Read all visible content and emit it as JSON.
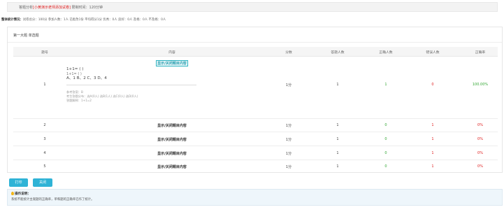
{
  "header": {
    "text_pre": "答题分析",
    "text_red": "[小黄演示老师添加试卷]",
    "text_post": "   限制时间：120分钟"
  },
  "stats": {
    "label": "整体统计情况：",
    "text": "试卷总分：100分  参加人数：1人  已批改1份  平均得分1分  优秀：0人  良好：0人  及格：0人  不及格：0人"
  },
  "section": {
    "title": "第一大题  单选题"
  },
  "table": {
    "headers": [
      "题号",
      "内容",
      "分数",
      "答题人数",
      "正确人数",
      "错误人数",
      "正确率"
    ],
    "toggle_label": "显示/关闭题目内容",
    "rows": [
      {
        "no": "1",
        "score": "1分",
        "answered": "1",
        "correct": "1",
        "wrong": "0",
        "rate": "100.00%",
        "expanded": true,
        "question_lines": [
          "1+1= ( )",
          "1+1= ( )",
          "A、1  B、2  C、3  D、4"
        ],
        "meta_lines": [
          "参考答案：B",
          "考生答题分布：选A(0人) 选B(1人) 选C(0人) 选D(0人)",
          "答题解释：1+1=2"
        ]
      },
      {
        "no": "2",
        "score": "1分",
        "answered": "1",
        "correct": "0",
        "wrong": "1",
        "rate": "0%"
      },
      {
        "no": "3",
        "score": "1分",
        "answered": "1",
        "correct": "0",
        "wrong": "1",
        "rate": "0%"
      },
      {
        "no": "4",
        "score": "1分",
        "answered": "1",
        "correct": "0",
        "wrong": "1",
        "rate": "0%"
      },
      {
        "no": "5",
        "score": "1分",
        "answered": "1",
        "correct": "0",
        "wrong": "1",
        "rate": "0%"
      }
    ]
  },
  "buttons": {
    "print": "打印",
    "close": "关闭"
  },
  "note": {
    "title": "操作说明：",
    "text": "系统不能统计主观题的正确率，单和题的正确率已作了统计。"
  },
  "colors": {
    "accent": "#2fb3d6",
    "correct": "#35a836",
    "wrong": "#e02020"
  }
}
